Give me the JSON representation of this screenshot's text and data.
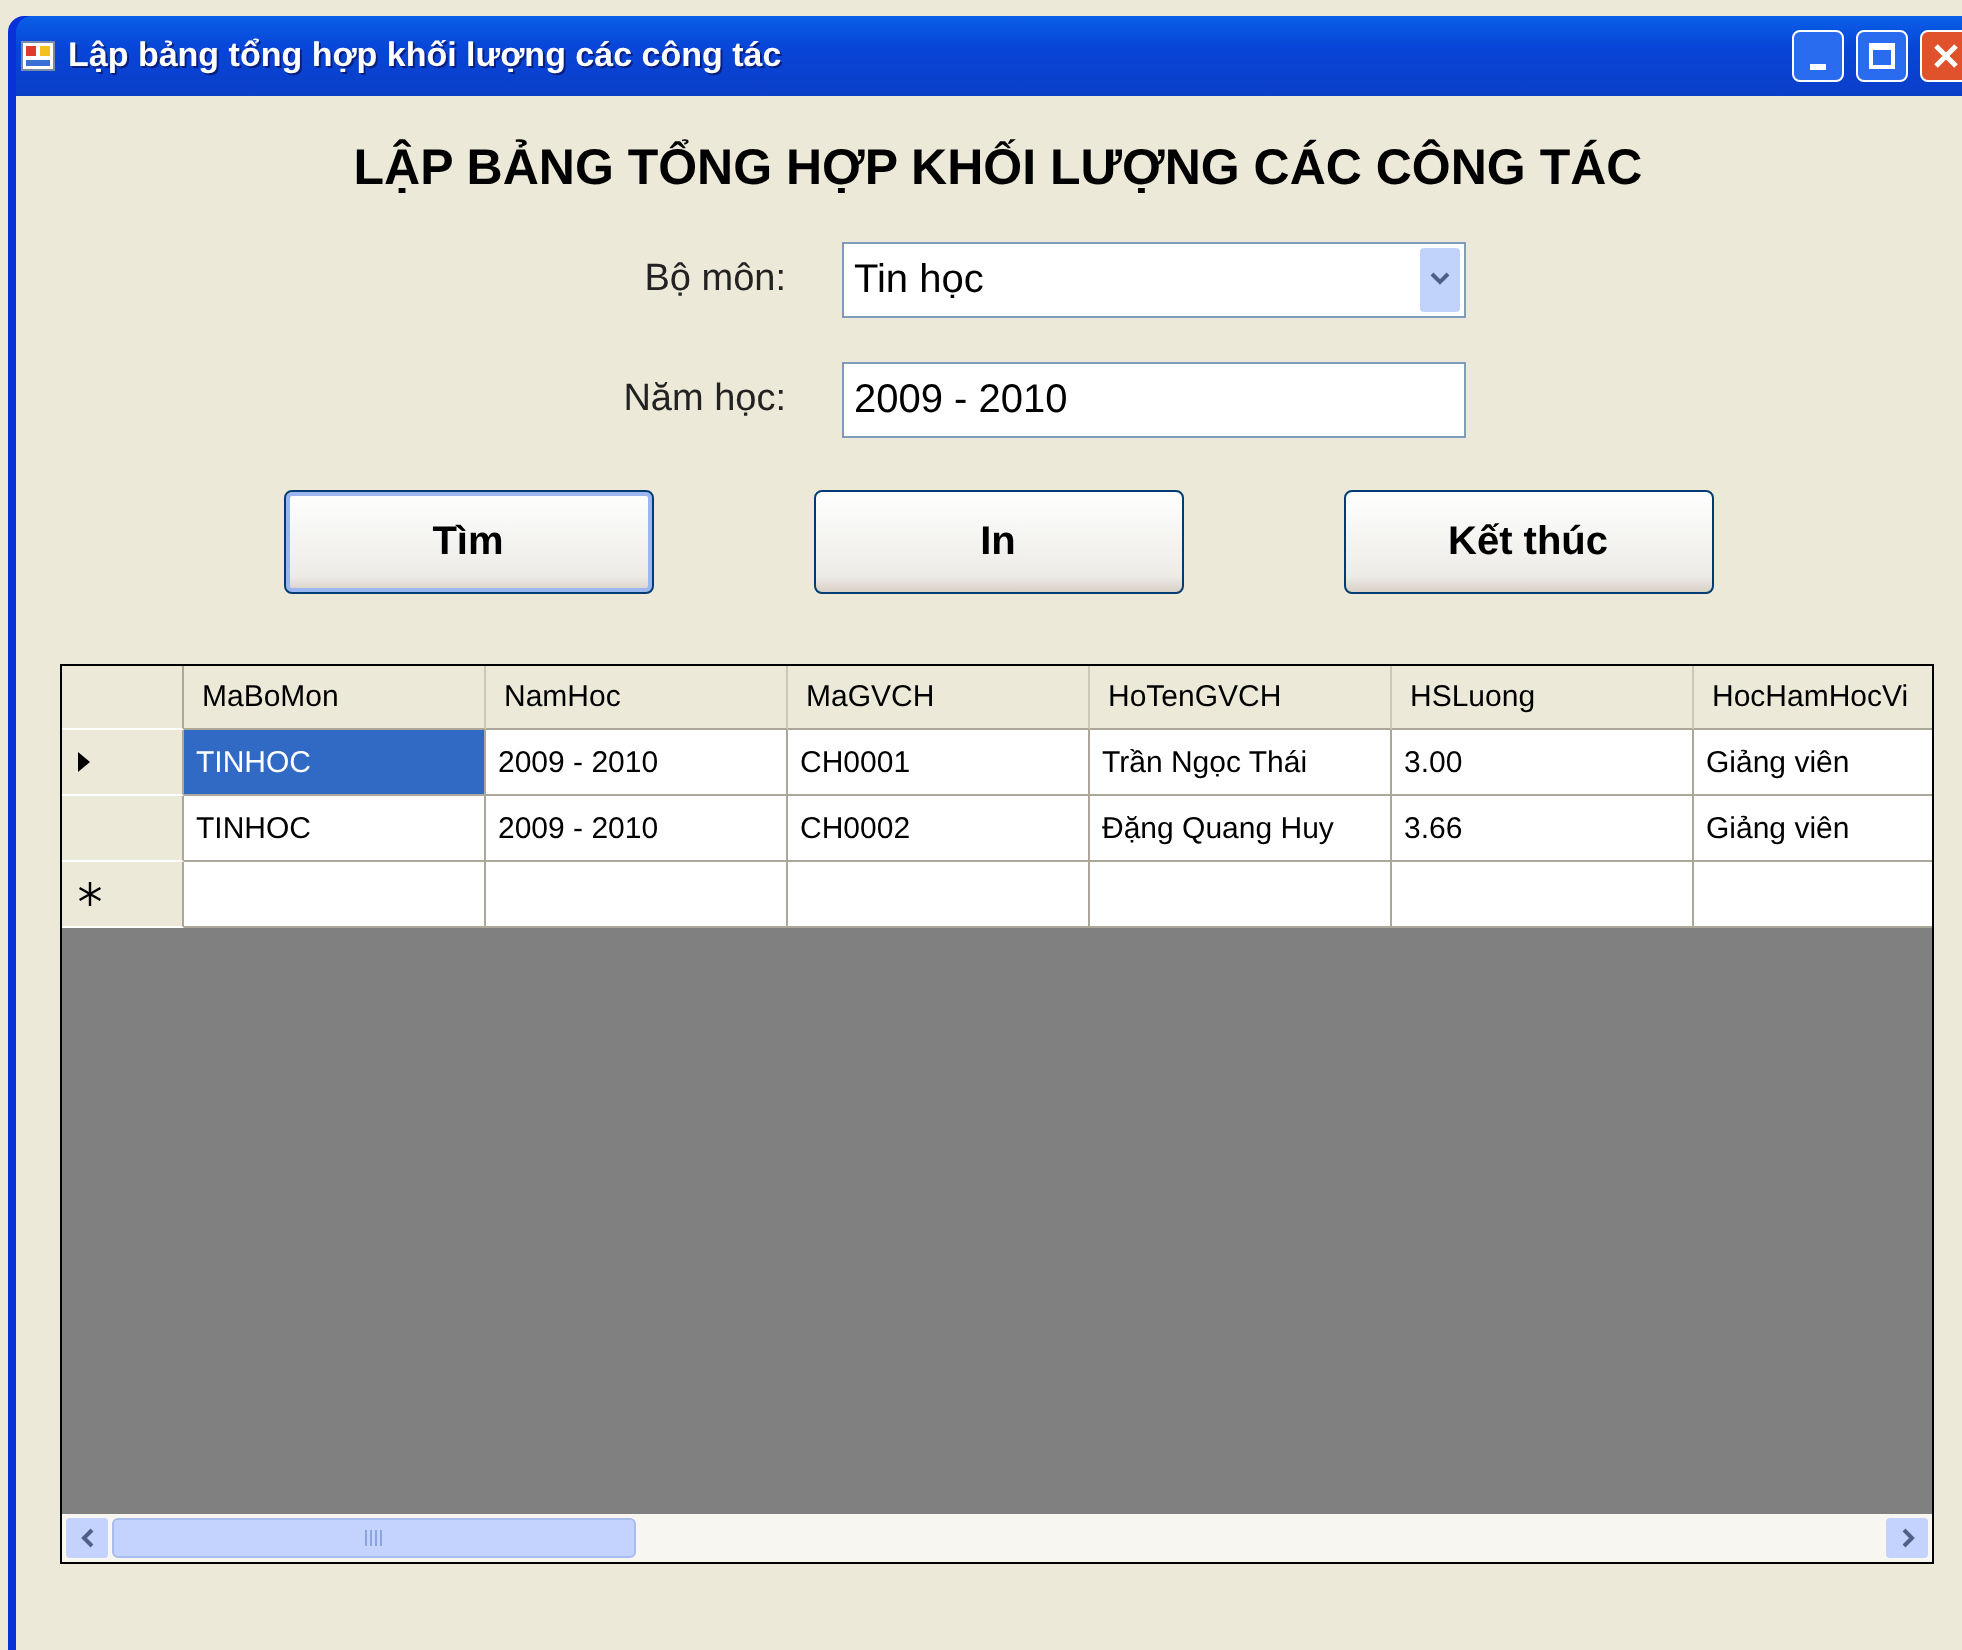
{
  "window": {
    "title": "Lập bảng tổng hợp khối lượng các công tác"
  },
  "heading": "LẬP BẢNG TỔNG HỢP KHỐI LƯỢNG CÁC CÔNG TÁC",
  "form": [
    {
      "kind": "dropdown",
      "label": "Bộ môn:",
      "value": "Tin học"
    },
    {
      "kind": "text",
      "label": "Năm học:",
      "value": "2009 - 2010"
    }
  ],
  "buttons": [
    {
      "label": "Tìm",
      "focused": true
    },
    {
      "label": "In",
      "focused": false
    },
    {
      "label": "Kết thúc",
      "focused": false
    }
  ],
  "table": {
    "columns": [
      "MaBoMon",
      "NamHoc",
      "MaGVCH",
      "HoTenGVCH",
      "HSLuong",
      "HocHamHocVi"
    ],
    "rows": [
      {
        "current": true,
        "cells": [
          {
            "text": "TINHOC",
            "selected": true
          },
          {
            "text": "2009 - 2010",
            "selected": false
          },
          {
            "text": "CH0001",
            "selected": false
          },
          {
            "text": "Trần Ngọc Thái",
            "selected": false
          },
          {
            "text": "3.00",
            "selected": false
          },
          {
            "text": "Giảng viên",
            "selected": false
          }
        ]
      },
      {
        "current": false,
        "cells": [
          {
            "text": "TINHOC",
            "selected": false
          },
          {
            "text": "2009 - 2010",
            "selected": false
          },
          {
            "text": "CH0002",
            "selected": false
          },
          {
            "text": "Đặng Quang Huy",
            "selected": false
          },
          {
            "text": "3.66",
            "selected": false
          },
          {
            "text": "Giảng viên",
            "selected": false
          }
        ]
      }
    ],
    "new_row": true
  }
}
